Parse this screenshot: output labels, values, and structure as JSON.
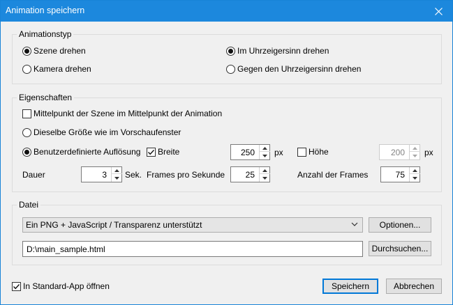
{
  "window": {
    "title": "Animation speichern"
  },
  "animation_type": {
    "legend": "Animationstyp",
    "rotate_scene": "Szene drehen",
    "rotate_camera": "Kamera drehen",
    "clockwise": "Im Uhrzeigersinn drehen",
    "counter_clockwise": "Gegen den Uhrzeigersinn drehen"
  },
  "properties": {
    "legend": "Eigenschaften",
    "center_label": "Mittelpunkt der Szene im Mittelpunkt der Animation",
    "same_size_label": "Dieselbe Größe wie im Vorschaufenster",
    "custom_res_label": "Benutzerdefinierte Auflösung",
    "width_label": "Breite",
    "width_value": "250",
    "width_unit": "px",
    "height_label": "Höhe",
    "height_value": "200",
    "height_unit": "px",
    "duration_label": "Dauer",
    "duration_value": "3",
    "duration_unit": "Sek.",
    "fps_label": "Frames pro Sekunde",
    "fps_value": "25",
    "frames_label": "Anzahl der Frames",
    "frames_value": "75"
  },
  "file": {
    "legend": "Datei",
    "format_value": "Ein PNG + JavaScript / Transparenz unterstützt",
    "options_button": "Optionen...",
    "path_value": "D:\\main_sample.html",
    "browse_button": "Durchsuchen..."
  },
  "footer": {
    "open_default_label": "In Standard-App öffnen",
    "save_button": "Speichern",
    "cancel_button": "Abbrechen"
  }
}
